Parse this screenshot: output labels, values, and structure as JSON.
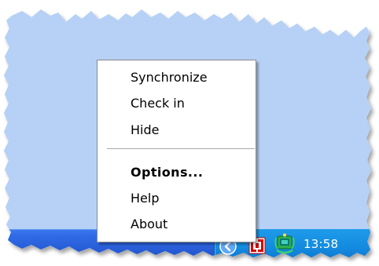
{
  "tray": {
    "clock": "13:58",
    "icons": [
      "chevron-left-icon",
      "red-app-icon",
      "network-sync-icon"
    ]
  },
  "menu": {
    "items": [
      {
        "label": "Synchronize"
      },
      {
        "label": "Check in"
      },
      {
        "label": "Hide"
      },
      {
        "label": "Options...",
        "bold": true
      },
      {
        "label": "Help"
      },
      {
        "label": "About"
      }
    ]
  },
  "colors": {
    "desktop": "#b6d1f5",
    "taskbar": "#2a63d8",
    "menu_bg": "#ffffff"
  }
}
